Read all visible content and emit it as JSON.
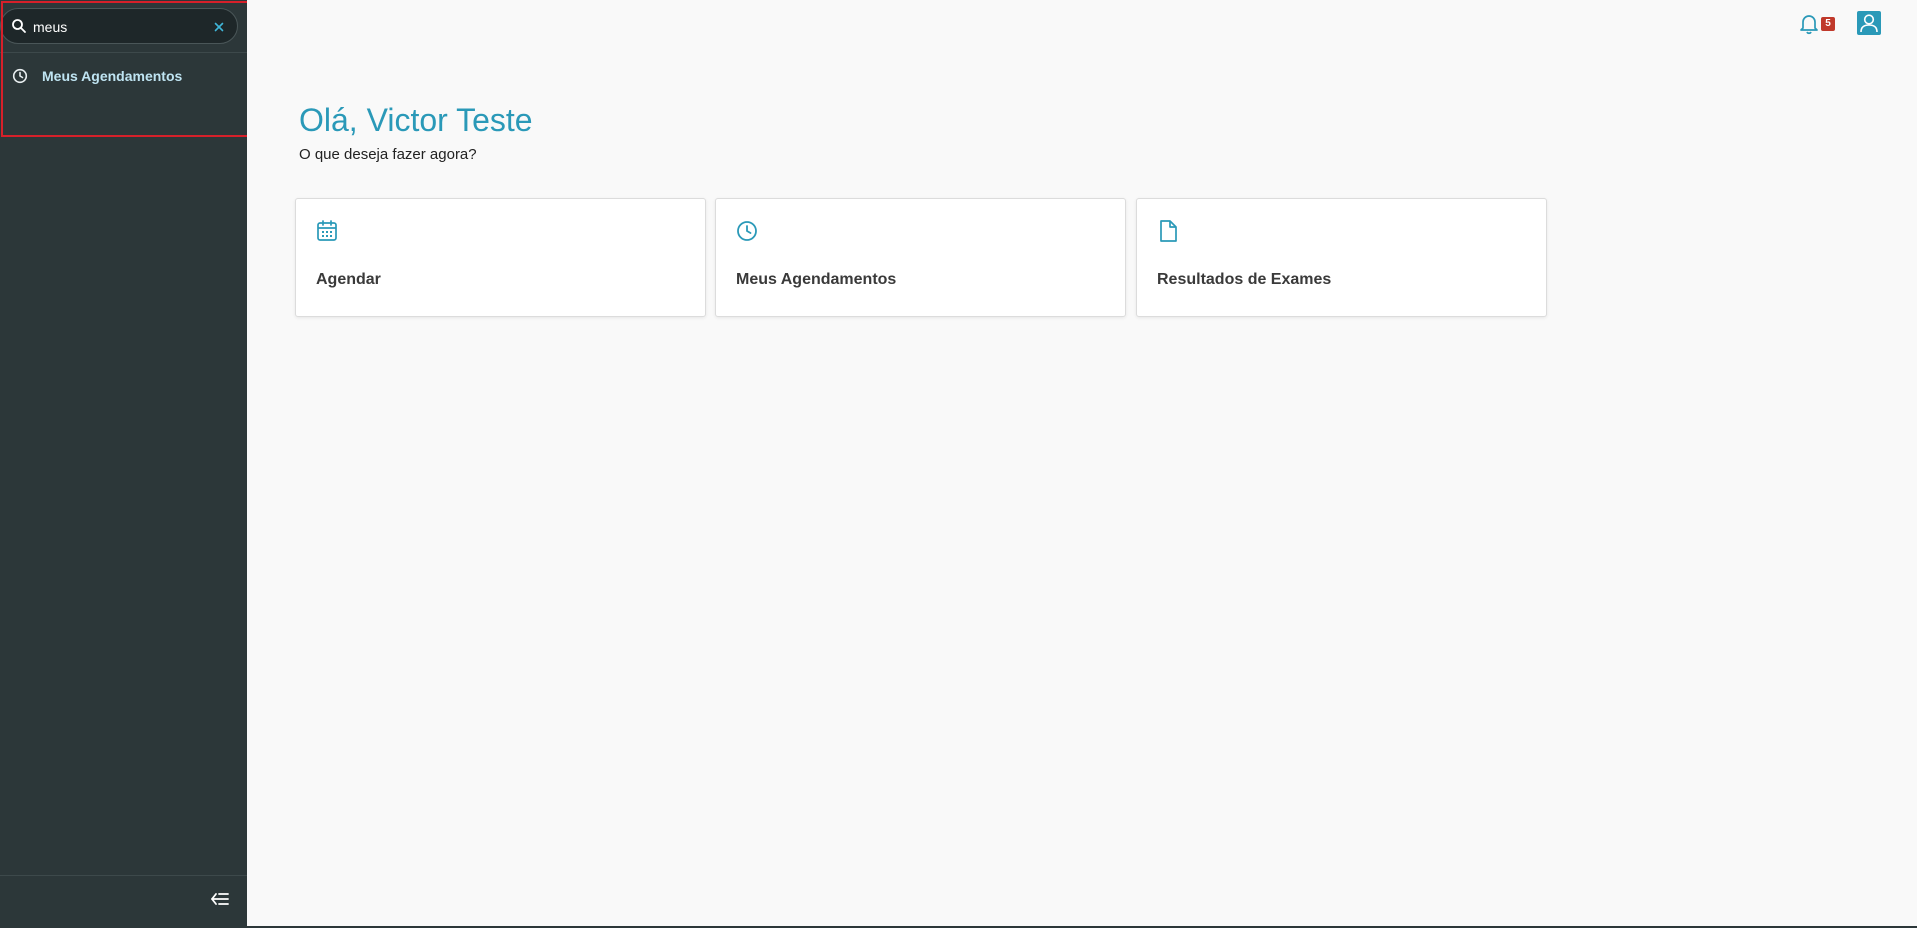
{
  "sidebar": {
    "search": {
      "value": "meus",
      "placeholder": ""
    },
    "items": [
      {
        "label": "Meus Agendamentos",
        "icon": "clock-icon"
      }
    ],
    "collapse_icon": "collapse-menu-icon"
  },
  "header": {
    "notifications": {
      "count": "5",
      "icon": "bell-icon"
    },
    "user_icon": "user-icon"
  },
  "main": {
    "greeting": "Olá, Victor Teste",
    "subtitle": "O que deseja fazer agora?",
    "cards": [
      {
        "label": "Agendar",
        "icon": "calendar-icon"
      },
      {
        "label": "Meus Agendamentos",
        "icon": "clock-icon"
      },
      {
        "label": "Resultados de Exames",
        "icon": "document-icon"
      }
    ]
  },
  "colors": {
    "sidebar_bg": "#2c3739",
    "accent": "#2a99b8",
    "highlight": "#d7202a",
    "badge": "#c0392b"
  }
}
